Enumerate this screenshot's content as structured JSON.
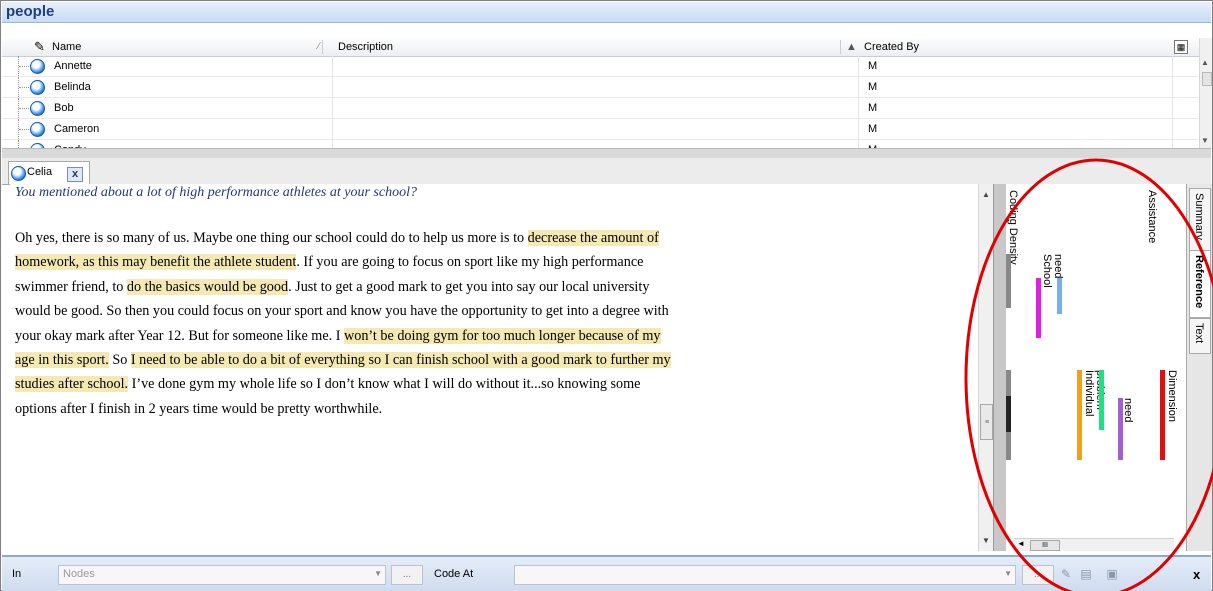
{
  "panel": {
    "title": "people"
  },
  "list": {
    "columns": {
      "name": "Name",
      "description": "Description",
      "created_by": "Created By"
    },
    "rows": [
      {
        "name": "Annette",
        "description": "",
        "created_by": "M"
      },
      {
        "name": "Belinda",
        "description": "",
        "created_by": "M"
      },
      {
        "name": "Bob",
        "description": "",
        "created_by": "M"
      },
      {
        "name": "Cameron",
        "description": "",
        "created_by": "M"
      },
      {
        "name": "Candy",
        "description": "",
        "created_by": "M"
      }
    ]
  },
  "doc_tab": {
    "label": "Celia",
    "close": "x"
  },
  "document": {
    "question": "You mentioned about a lot of high performance athletes at your school?",
    "segments": [
      {
        "text": "Oh yes, there is so many of us. Maybe one thing our school could do to help us more is to ",
        "highlight": false
      },
      {
        "text": "decrease the amount of homework, as this may benefit the athlete student",
        "highlight": true
      },
      {
        "text": ". If you are going to focus on sport like my high performance swimmer friend, to ",
        "highlight": false
      },
      {
        "text": "do the basics would be good",
        "highlight": true
      },
      {
        "text": ". Just to get a good mark to get you into say our local university would be good. So then you could focus on your sport and know you have the opportunity to get into a degree with your okay mark after Year 12. But for someone like me. I ",
        "highlight": false
      },
      {
        "text": "won’t be doing gym for too much longer because of my age in this sport.",
        "highlight": true
      },
      {
        "text": " So ",
        "highlight": false
      },
      {
        "text": "I need to be able to do a bit of everything so I can finish school with a good mark to further my studies after school.",
        "highlight": true
      },
      {
        "text": " I’ve done gym my whole life so I don’t know what I will do without it...so knowing some options after I finish in 2 years time would be pretty worthwhile.",
        "highlight": false
      }
    ]
  },
  "stripes": {
    "labels": {
      "coding_density": "Coding Density",
      "assistance": "Assistance",
      "need_school_1": "need",
      "need_school_2": "School",
      "dimension": "Dimension",
      "need": "need",
      "problem": "problem",
      "individual": "Individual"
    },
    "colors": {
      "school": "#e020e0",
      "need_school": "#7ab0e0",
      "individual": "#f0a020",
      "problem": "#20e080",
      "need": "#a060d0",
      "dimension": "#e01010",
      "density_dark": "#222222",
      "density_mid": "#888888"
    }
  },
  "right_tabs": {
    "summary": "Summary",
    "reference": "Reference",
    "text": "Text"
  },
  "annotation_color": "#e00000",
  "bottom": {
    "in_label": "In",
    "nodes_placeholder": "Nodes",
    "dots": "...",
    "code_at_label": "Code At",
    "close": "x"
  }
}
